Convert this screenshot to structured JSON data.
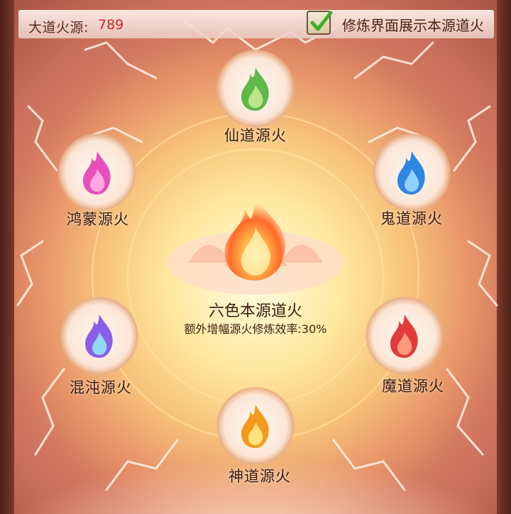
{
  "header": {
    "fire_source_label": "大道火源:",
    "fire_source_value": "789",
    "show_option_label": "修炼界面展示本源道火",
    "show_option_checked": true
  },
  "center": {
    "title": "六色本源道火",
    "description": "额外增幅源火修炼效率:30%"
  },
  "fires": [
    {
      "label": "仙道源火",
      "color": "green"
    },
    {
      "label": "鬼道源火",
      "color": "blue"
    },
    {
      "label": "魔道源火",
      "color": "red"
    },
    {
      "label": "神道源火",
      "color": "orange"
    },
    {
      "label": "混沌源火",
      "color": "purple"
    },
    {
      "label": "鸿蒙源火",
      "color": "pink"
    }
  ],
  "colors": {
    "value_red": "#d2232a",
    "check_green": "#3fae2a"
  }
}
